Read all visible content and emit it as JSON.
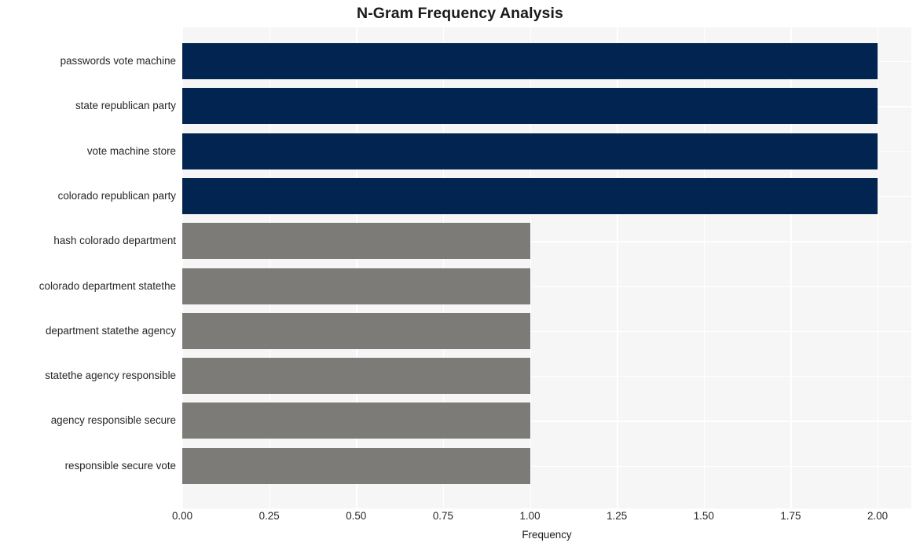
{
  "chart_data": {
    "type": "bar",
    "orientation": "horizontal",
    "title": "N-Gram Frequency Analysis",
    "xlabel": "Frequency",
    "ylabel": "",
    "categories": [
      "passwords vote machine",
      "state republican party",
      "vote machine store",
      "colorado republican party",
      "hash colorado department",
      "colorado department statethe",
      "department statethe agency",
      "statethe agency responsible",
      "agency responsible secure",
      "responsible secure vote"
    ],
    "values": [
      2,
      2,
      2,
      2,
      1,
      1,
      1,
      1,
      1,
      1
    ],
    "bar_colors": [
      "#012451",
      "#012451",
      "#012451",
      "#012451",
      "#7c7b78",
      "#7c7b78",
      "#7c7b78",
      "#7c7b78",
      "#7c7b78",
      "#7c7b78"
    ],
    "xlim": [
      0,
      2.0
    ],
    "xticks": [
      0,
      0.25,
      0.5,
      0.75,
      1.0,
      1.25,
      1.5,
      1.75,
      2.0
    ],
    "xticklabels": [
      "0.00",
      "0.25",
      "0.50",
      "0.75",
      "1.00",
      "1.25",
      "1.50",
      "1.75",
      "2.00"
    ],
    "grid": true,
    "legend": null,
    "theme": {
      "figure_background": "#ffffff",
      "plot_background": "#f6f6f6",
      "gridline_color": "#ffffff",
      "text_color": "#262626",
      "title_color": "#1a1a1a",
      "highlight_color": "#012451",
      "secondary_color": "#7c7b78"
    }
  }
}
